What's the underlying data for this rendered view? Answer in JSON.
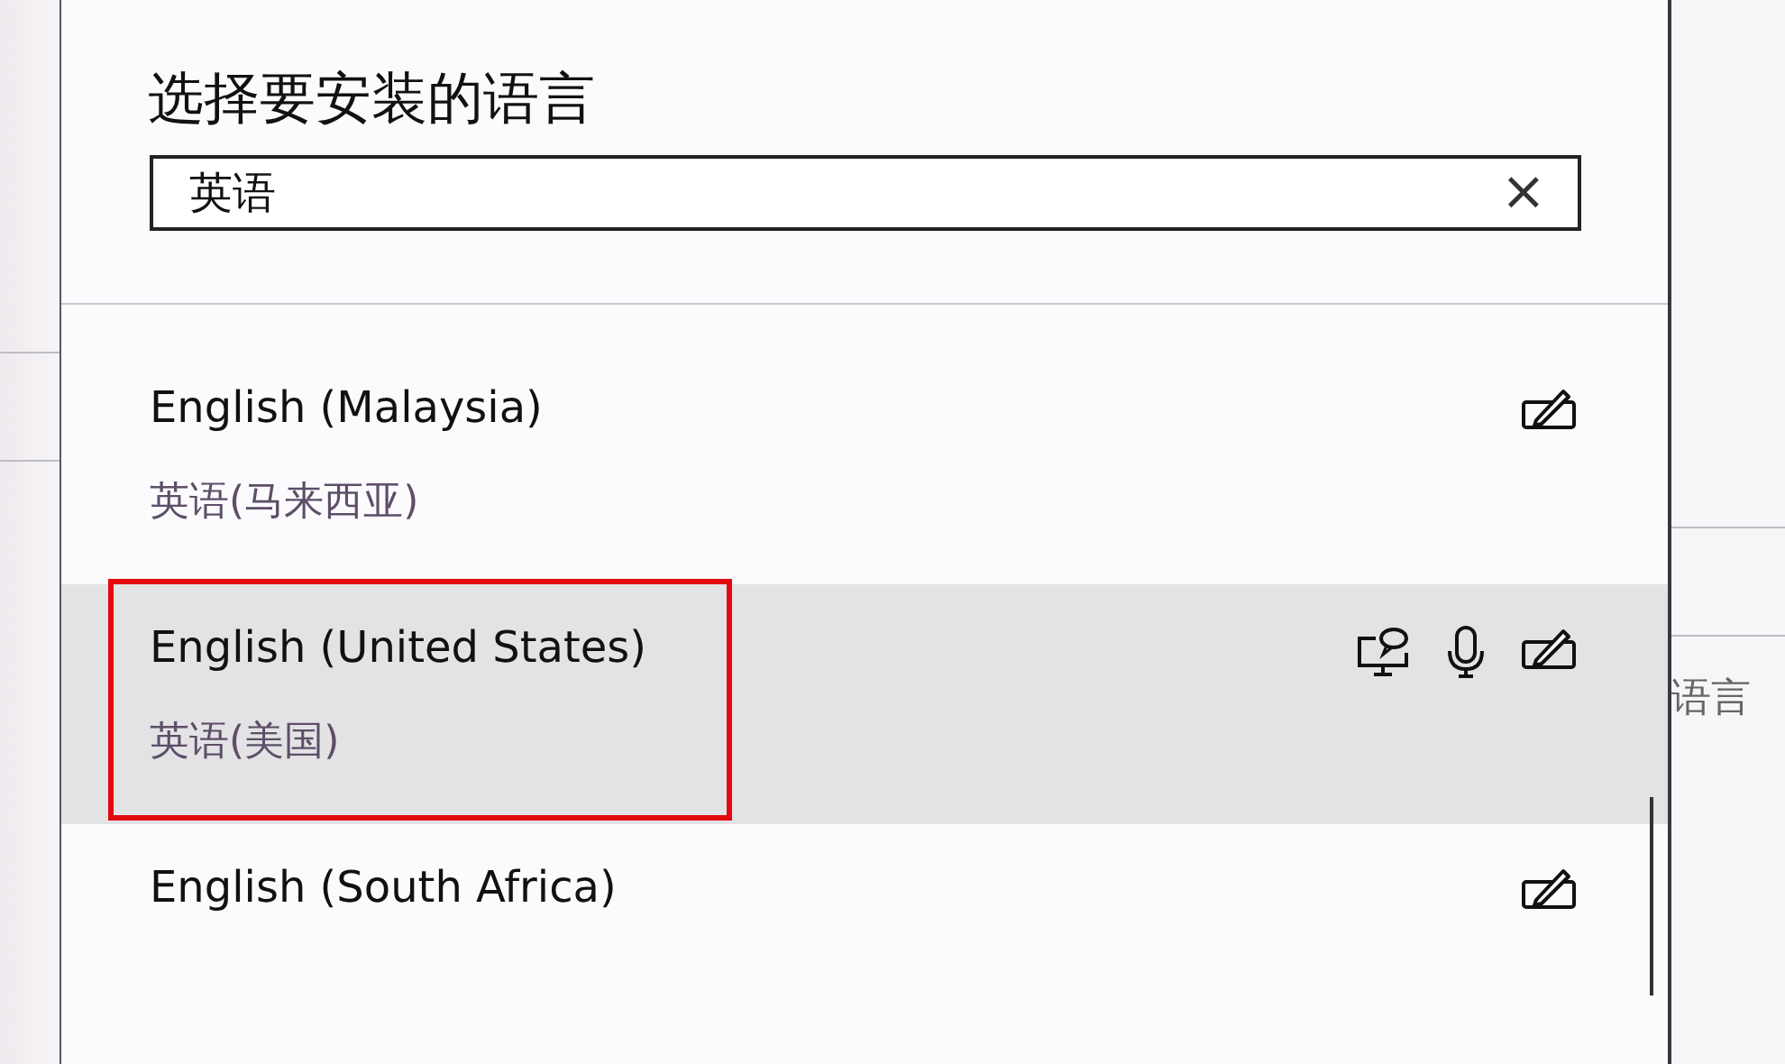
{
  "dialog": {
    "title": "选择要安装的语言",
    "search": {
      "value": "英语",
      "clear": "×"
    }
  },
  "languages": [
    {
      "name": "English (Malaysia)",
      "native": "英语(马来西亚)",
      "selected": false,
      "annotated": false,
      "text_to_speech": false,
      "speech": false,
      "handwriting": true
    },
    {
      "name": "English (United States)",
      "native": "英语(美国)",
      "selected": true,
      "annotated": true,
      "text_to_speech": true,
      "speech": true,
      "handwriting": true
    },
    {
      "name": "English (South Africa)",
      "selected": false,
      "annotated": false,
      "text_to_speech": false,
      "speech": false,
      "handwriting": true
    }
  ],
  "background": {
    "right_text": "语言"
  }
}
